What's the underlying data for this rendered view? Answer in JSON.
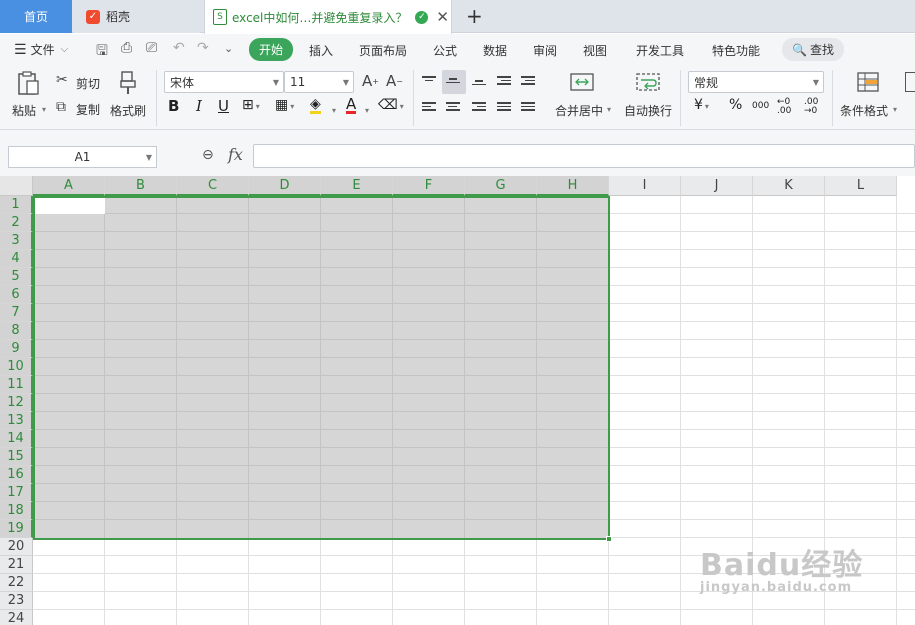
{
  "tabs": {
    "home": "首页",
    "daoke": "稻壳",
    "document": "excel中如何…并避免重复录入？"
  },
  "menu": {
    "file": "文件",
    "items": [
      "开始",
      "插入",
      "页面布局",
      "公式",
      "数据",
      "审阅",
      "视图",
      "开发工具",
      "特色功能"
    ],
    "active": "开始",
    "search": "查找"
  },
  "ribbon": {
    "paste": "粘贴",
    "cut": "剪切",
    "copy": "复制",
    "format_painter": "格式刷",
    "font_name": "宋体",
    "font_size": "11",
    "bold": "B",
    "italic": "I",
    "underline": "U",
    "font_color_glyph": "A",
    "merge_center": "合并居中",
    "wrap_text": "自动换行",
    "number_format": "常规",
    "currency": "¥",
    "percent": "%",
    "thousands": "000",
    "cond_format": "条件格式"
  },
  "formula_bar": {
    "name_box": "A1",
    "fx": "fx",
    "value": ""
  },
  "grid": {
    "columns": [
      "A",
      "B",
      "C",
      "D",
      "E",
      "F",
      "G",
      "H",
      "I",
      "J",
      "K",
      "L"
    ],
    "rows": [
      "1",
      "2",
      "3",
      "4",
      "5",
      "6",
      "7",
      "8",
      "9",
      "10",
      "11",
      "12",
      "13",
      "14",
      "15",
      "16",
      "17",
      "18",
      "19",
      "20",
      "21",
      "22",
      "23",
      "24"
    ],
    "selection": "A1:H19",
    "active_cell": "A1"
  },
  "watermark": {
    "main": "Baidu经验",
    "sub": "jingyan.baidu.com"
  },
  "colors": {
    "accent": "#3ba55c",
    "home_tab": "#4a90e2",
    "selection_border": "#3f9a4a",
    "selection_fill": "#d6d6d6"
  }
}
